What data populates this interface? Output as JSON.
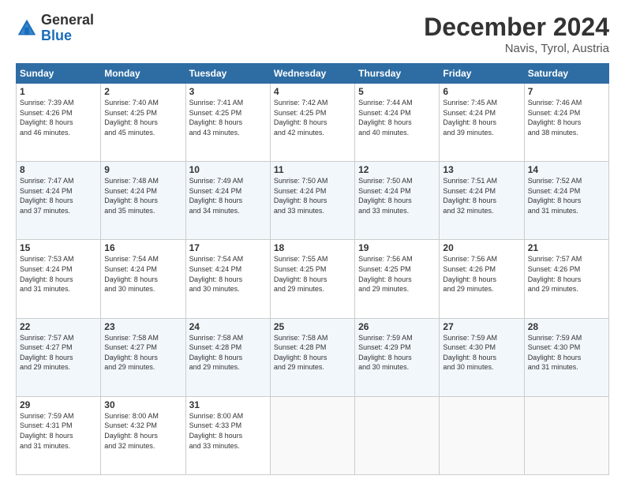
{
  "header": {
    "logo_general": "General",
    "logo_blue": "Blue",
    "month_title": "December 2024",
    "location": "Navis, Tyrol, Austria"
  },
  "days_of_week": [
    "Sunday",
    "Monday",
    "Tuesday",
    "Wednesday",
    "Thursday",
    "Friday",
    "Saturday"
  ],
  "weeks": [
    [
      {
        "day": "1",
        "sunrise": "7:39 AM",
        "sunset": "4:26 PM",
        "daylight": "8 hours and 46 minutes."
      },
      {
        "day": "2",
        "sunrise": "7:40 AM",
        "sunset": "4:25 PM",
        "daylight": "8 hours and 45 minutes."
      },
      {
        "day": "3",
        "sunrise": "7:41 AM",
        "sunset": "4:25 PM",
        "daylight": "8 hours and 43 minutes."
      },
      {
        "day": "4",
        "sunrise": "7:42 AM",
        "sunset": "4:25 PM",
        "daylight": "8 hours and 42 minutes."
      },
      {
        "day": "5",
        "sunrise": "7:44 AM",
        "sunset": "4:24 PM",
        "daylight": "8 hours and 40 minutes."
      },
      {
        "day": "6",
        "sunrise": "7:45 AM",
        "sunset": "4:24 PM",
        "daylight": "8 hours and 39 minutes."
      },
      {
        "day": "7",
        "sunrise": "7:46 AM",
        "sunset": "4:24 PM",
        "daylight": "8 hours and 38 minutes."
      }
    ],
    [
      {
        "day": "8",
        "sunrise": "7:47 AM",
        "sunset": "4:24 PM",
        "daylight": "8 hours and 37 minutes."
      },
      {
        "day": "9",
        "sunrise": "7:48 AM",
        "sunset": "4:24 PM",
        "daylight": "8 hours and 35 minutes."
      },
      {
        "day": "10",
        "sunrise": "7:49 AM",
        "sunset": "4:24 PM",
        "daylight": "8 hours and 34 minutes."
      },
      {
        "day": "11",
        "sunrise": "7:50 AM",
        "sunset": "4:24 PM",
        "daylight": "8 hours and 33 minutes."
      },
      {
        "day": "12",
        "sunrise": "7:50 AM",
        "sunset": "4:24 PM",
        "daylight": "8 hours and 33 minutes."
      },
      {
        "day": "13",
        "sunrise": "7:51 AM",
        "sunset": "4:24 PM",
        "daylight": "8 hours and 32 minutes."
      },
      {
        "day": "14",
        "sunrise": "7:52 AM",
        "sunset": "4:24 PM",
        "daylight": "8 hours and 31 minutes."
      }
    ],
    [
      {
        "day": "15",
        "sunrise": "7:53 AM",
        "sunset": "4:24 PM",
        "daylight": "8 hours and 31 minutes."
      },
      {
        "day": "16",
        "sunrise": "7:54 AM",
        "sunset": "4:24 PM",
        "daylight": "8 hours and 30 minutes."
      },
      {
        "day": "17",
        "sunrise": "7:54 AM",
        "sunset": "4:24 PM",
        "daylight": "8 hours and 30 minutes."
      },
      {
        "day": "18",
        "sunrise": "7:55 AM",
        "sunset": "4:25 PM",
        "daylight": "8 hours and 29 minutes."
      },
      {
        "day": "19",
        "sunrise": "7:56 AM",
        "sunset": "4:25 PM",
        "daylight": "8 hours and 29 minutes."
      },
      {
        "day": "20",
        "sunrise": "7:56 AM",
        "sunset": "4:26 PM",
        "daylight": "8 hours and 29 minutes."
      },
      {
        "day": "21",
        "sunrise": "7:57 AM",
        "sunset": "4:26 PM",
        "daylight": "8 hours and 29 minutes."
      }
    ],
    [
      {
        "day": "22",
        "sunrise": "7:57 AM",
        "sunset": "4:27 PM",
        "daylight": "8 hours and 29 minutes."
      },
      {
        "day": "23",
        "sunrise": "7:58 AM",
        "sunset": "4:27 PM",
        "daylight": "8 hours and 29 minutes."
      },
      {
        "day": "24",
        "sunrise": "7:58 AM",
        "sunset": "4:28 PM",
        "daylight": "8 hours and 29 minutes."
      },
      {
        "day": "25",
        "sunrise": "7:58 AM",
        "sunset": "4:28 PM",
        "daylight": "8 hours and 29 minutes."
      },
      {
        "day": "26",
        "sunrise": "7:59 AM",
        "sunset": "4:29 PM",
        "daylight": "8 hours and 30 minutes."
      },
      {
        "day": "27",
        "sunrise": "7:59 AM",
        "sunset": "4:30 PM",
        "daylight": "8 hours and 30 minutes."
      },
      {
        "day": "28",
        "sunrise": "7:59 AM",
        "sunset": "4:30 PM",
        "daylight": "8 hours and 31 minutes."
      }
    ],
    [
      {
        "day": "29",
        "sunrise": "7:59 AM",
        "sunset": "4:31 PM",
        "daylight": "8 hours and 31 minutes."
      },
      {
        "day": "30",
        "sunrise": "8:00 AM",
        "sunset": "4:32 PM",
        "daylight": "8 hours and 32 minutes."
      },
      {
        "day": "31",
        "sunrise": "8:00 AM",
        "sunset": "4:33 PM",
        "daylight": "8 hours and 33 minutes."
      },
      null,
      null,
      null,
      null
    ]
  ],
  "labels": {
    "sunrise": "Sunrise:",
    "sunset": "Sunset:",
    "daylight": "Daylight:"
  }
}
